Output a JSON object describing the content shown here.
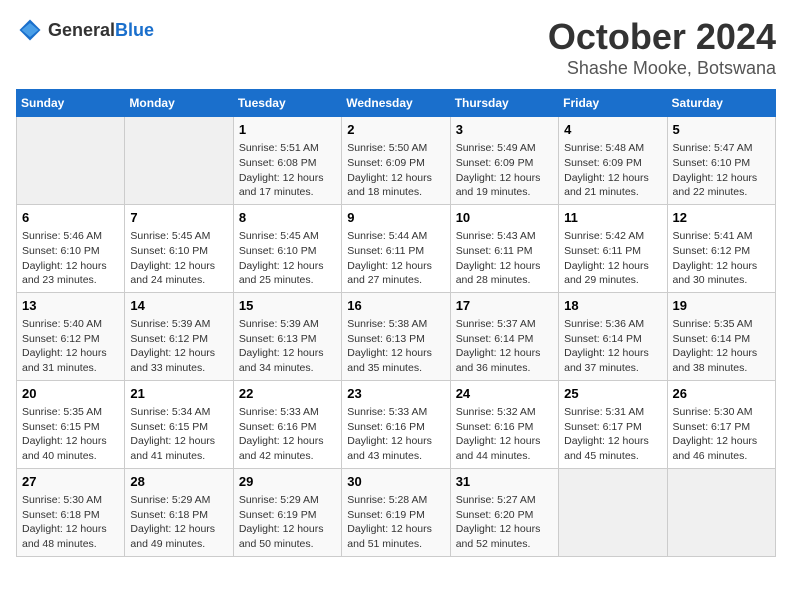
{
  "logo": {
    "general": "General",
    "blue": "Blue"
  },
  "title": "October 2024",
  "location": "Shashe Mooke, Botswana",
  "weekdays": [
    "Sunday",
    "Monday",
    "Tuesday",
    "Wednesday",
    "Thursday",
    "Friday",
    "Saturday"
  ],
  "weeks": [
    [
      {
        "day": "",
        "sunrise": "",
        "sunset": "",
        "daylight": ""
      },
      {
        "day": "",
        "sunrise": "",
        "sunset": "",
        "daylight": ""
      },
      {
        "day": "1",
        "sunrise": "Sunrise: 5:51 AM",
        "sunset": "Sunset: 6:08 PM",
        "daylight": "Daylight: 12 hours and 17 minutes."
      },
      {
        "day": "2",
        "sunrise": "Sunrise: 5:50 AM",
        "sunset": "Sunset: 6:09 PM",
        "daylight": "Daylight: 12 hours and 18 minutes."
      },
      {
        "day": "3",
        "sunrise": "Sunrise: 5:49 AM",
        "sunset": "Sunset: 6:09 PM",
        "daylight": "Daylight: 12 hours and 19 minutes."
      },
      {
        "day": "4",
        "sunrise": "Sunrise: 5:48 AM",
        "sunset": "Sunset: 6:09 PM",
        "daylight": "Daylight: 12 hours and 21 minutes."
      },
      {
        "day": "5",
        "sunrise": "Sunrise: 5:47 AM",
        "sunset": "Sunset: 6:10 PM",
        "daylight": "Daylight: 12 hours and 22 minutes."
      }
    ],
    [
      {
        "day": "6",
        "sunrise": "Sunrise: 5:46 AM",
        "sunset": "Sunset: 6:10 PM",
        "daylight": "Daylight: 12 hours and 23 minutes."
      },
      {
        "day": "7",
        "sunrise": "Sunrise: 5:45 AM",
        "sunset": "Sunset: 6:10 PM",
        "daylight": "Daylight: 12 hours and 24 minutes."
      },
      {
        "day": "8",
        "sunrise": "Sunrise: 5:45 AM",
        "sunset": "Sunset: 6:10 PM",
        "daylight": "Daylight: 12 hours and 25 minutes."
      },
      {
        "day": "9",
        "sunrise": "Sunrise: 5:44 AM",
        "sunset": "Sunset: 6:11 PM",
        "daylight": "Daylight: 12 hours and 27 minutes."
      },
      {
        "day": "10",
        "sunrise": "Sunrise: 5:43 AM",
        "sunset": "Sunset: 6:11 PM",
        "daylight": "Daylight: 12 hours and 28 minutes."
      },
      {
        "day": "11",
        "sunrise": "Sunrise: 5:42 AM",
        "sunset": "Sunset: 6:11 PM",
        "daylight": "Daylight: 12 hours and 29 minutes."
      },
      {
        "day": "12",
        "sunrise": "Sunrise: 5:41 AM",
        "sunset": "Sunset: 6:12 PM",
        "daylight": "Daylight: 12 hours and 30 minutes."
      }
    ],
    [
      {
        "day": "13",
        "sunrise": "Sunrise: 5:40 AM",
        "sunset": "Sunset: 6:12 PM",
        "daylight": "Daylight: 12 hours and 31 minutes."
      },
      {
        "day": "14",
        "sunrise": "Sunrise: 5:39 AM",
        "sunset": "Sunset: 6:12 PM",
        "daylight": "Daylight: 12 hours and 33 minutes."
      },
      {
        "day": "15",
        "sunrise": "Sunrise: 5:39 AM",
        "sunset": "Sunset: 6:13 PM",
        "daylight": "Daylight: 12 hours and 34 minutes."
      },
      {
        "day": "16",
        "sunrise": "Sunrise: 5:38 AM",
        "sunset": "Sunset: 6:13 PM",
        "daylight": "Daylight: 12 hours and 35 minutes."
      },
      {
        "day": "17",
        "sunrise": "Sunrise: 5:37 AM",
        "sunset": "Sunset: 6:14 PM",
        "daylight": "Daylight: 12 hours and 36 minutes."
      },
      {
        "day": "18",
        "sunrise": "Sunrise: 5:36 AM",
        "sunset": "Sunset: 6:14 PM",
        "daylight": "Daylight: 12 hours and 37 minutes."
      },
      {
        "day": "19",
        "sunrise": "Sunrise: 5:35 AM",
        "sunset": "Sunset: 6:14 PM",
        "daylight": "Daylight: 12 hours and 38 minutes."
      }
    ],
    [
      {
        "day": "20",
        "sunrise": "Sunrise: 5:35 AM",
        "sunset": "Sunset: 6:15 PM",
        "daylight": "Daylight: 12 hours and 40 minutes."
      },
      {
        "day": "21",
        "sunrise": "Sunrise: 5:34 AM",
        "sunset": "Sunset: 6:15 PM",
        "daylight": "Daylight: 12 hours and 41 minutes."
      },
      {
        "day": "22",
        "sunrise": "Sunrise: 5:33 AM",
        "sunset": "Sunset: 6:16 PM",
        "daylight": "Daylight: 12 hours and 42 minutes."
      },
      {
        "day": "23",
        "sunrise": "Sunrise: 5:33 AM",
        "sunset": "Sunset: 6:16 PM",
        "daylight": "Daylight: 12 hours and 43 minutes."
      },
      {
        "day": "24",
        "sunrise": "Sunrise: 5:32 AM",
        "sunset": "Sunset: 6:16 PM",
        "daylight": "Daylight: 12 hours and 44 minutes."
      },
      {
        "day": "25",
        "sunrise": "Sunrise: 5:31 AM",
        "sunset": "Sunset: 6:17 PM",
        "daylight": "Daylight: 12 hours and 45 minutes."
      },
      {
        "day": "26",
        "sunrise": "Sunrise: 5:30 AM",
        "sunset": "Sunset: 6:17 PM",
        "daylight": "Daylight: 12 hours and 46 minutes."
      }
    ],
    [
      {
        "day": "27",
        "sunrise": "Sunrise: 5:30 AM",
        "sunset": "Sunset: 6:18 PM",
        "daylight": "Daylight: 12 hours and 48 minutes."
      },
      {
        "day": "28",
        "sunrise": "Sunrise: 5:29 AM",
        "sunset": "Sunset: 6:18 PM",
        "daylight": "Daylight: 12 hours and 49 minutes."
      },
      {
        "day": "29",
        "sunrise": "Sunrise: 5:29 AM",
        "sunset": "Sunset: 6:19 PM",
        "daylight": "Daylight: 12 hours and 50 minutes."
      },
      {
        "day": "30",
        "sunrise": "Sunrise: 5:28 AM",
        "sunset": "Sunset: 6:19 PM",
        "daylight": "Daylight: 12 hours and 51 minutes."
      },
      {
        "day": "31",
        "sunrise": "Sunrise: 5:27 AM",
        "sunset": "Sunset: 6:20 PM",
        "daylight": "Daylight: 12 hours and 52 minutes."
      },
      {
        "day": "",
        "sunrise": "",
        "sunset": "",
        "daylight": ""
      },
      {
        "day": "",
        "sunrise": "",
        "sunset": "",
        "daylight": ""
      }
    ]
  ]
}
